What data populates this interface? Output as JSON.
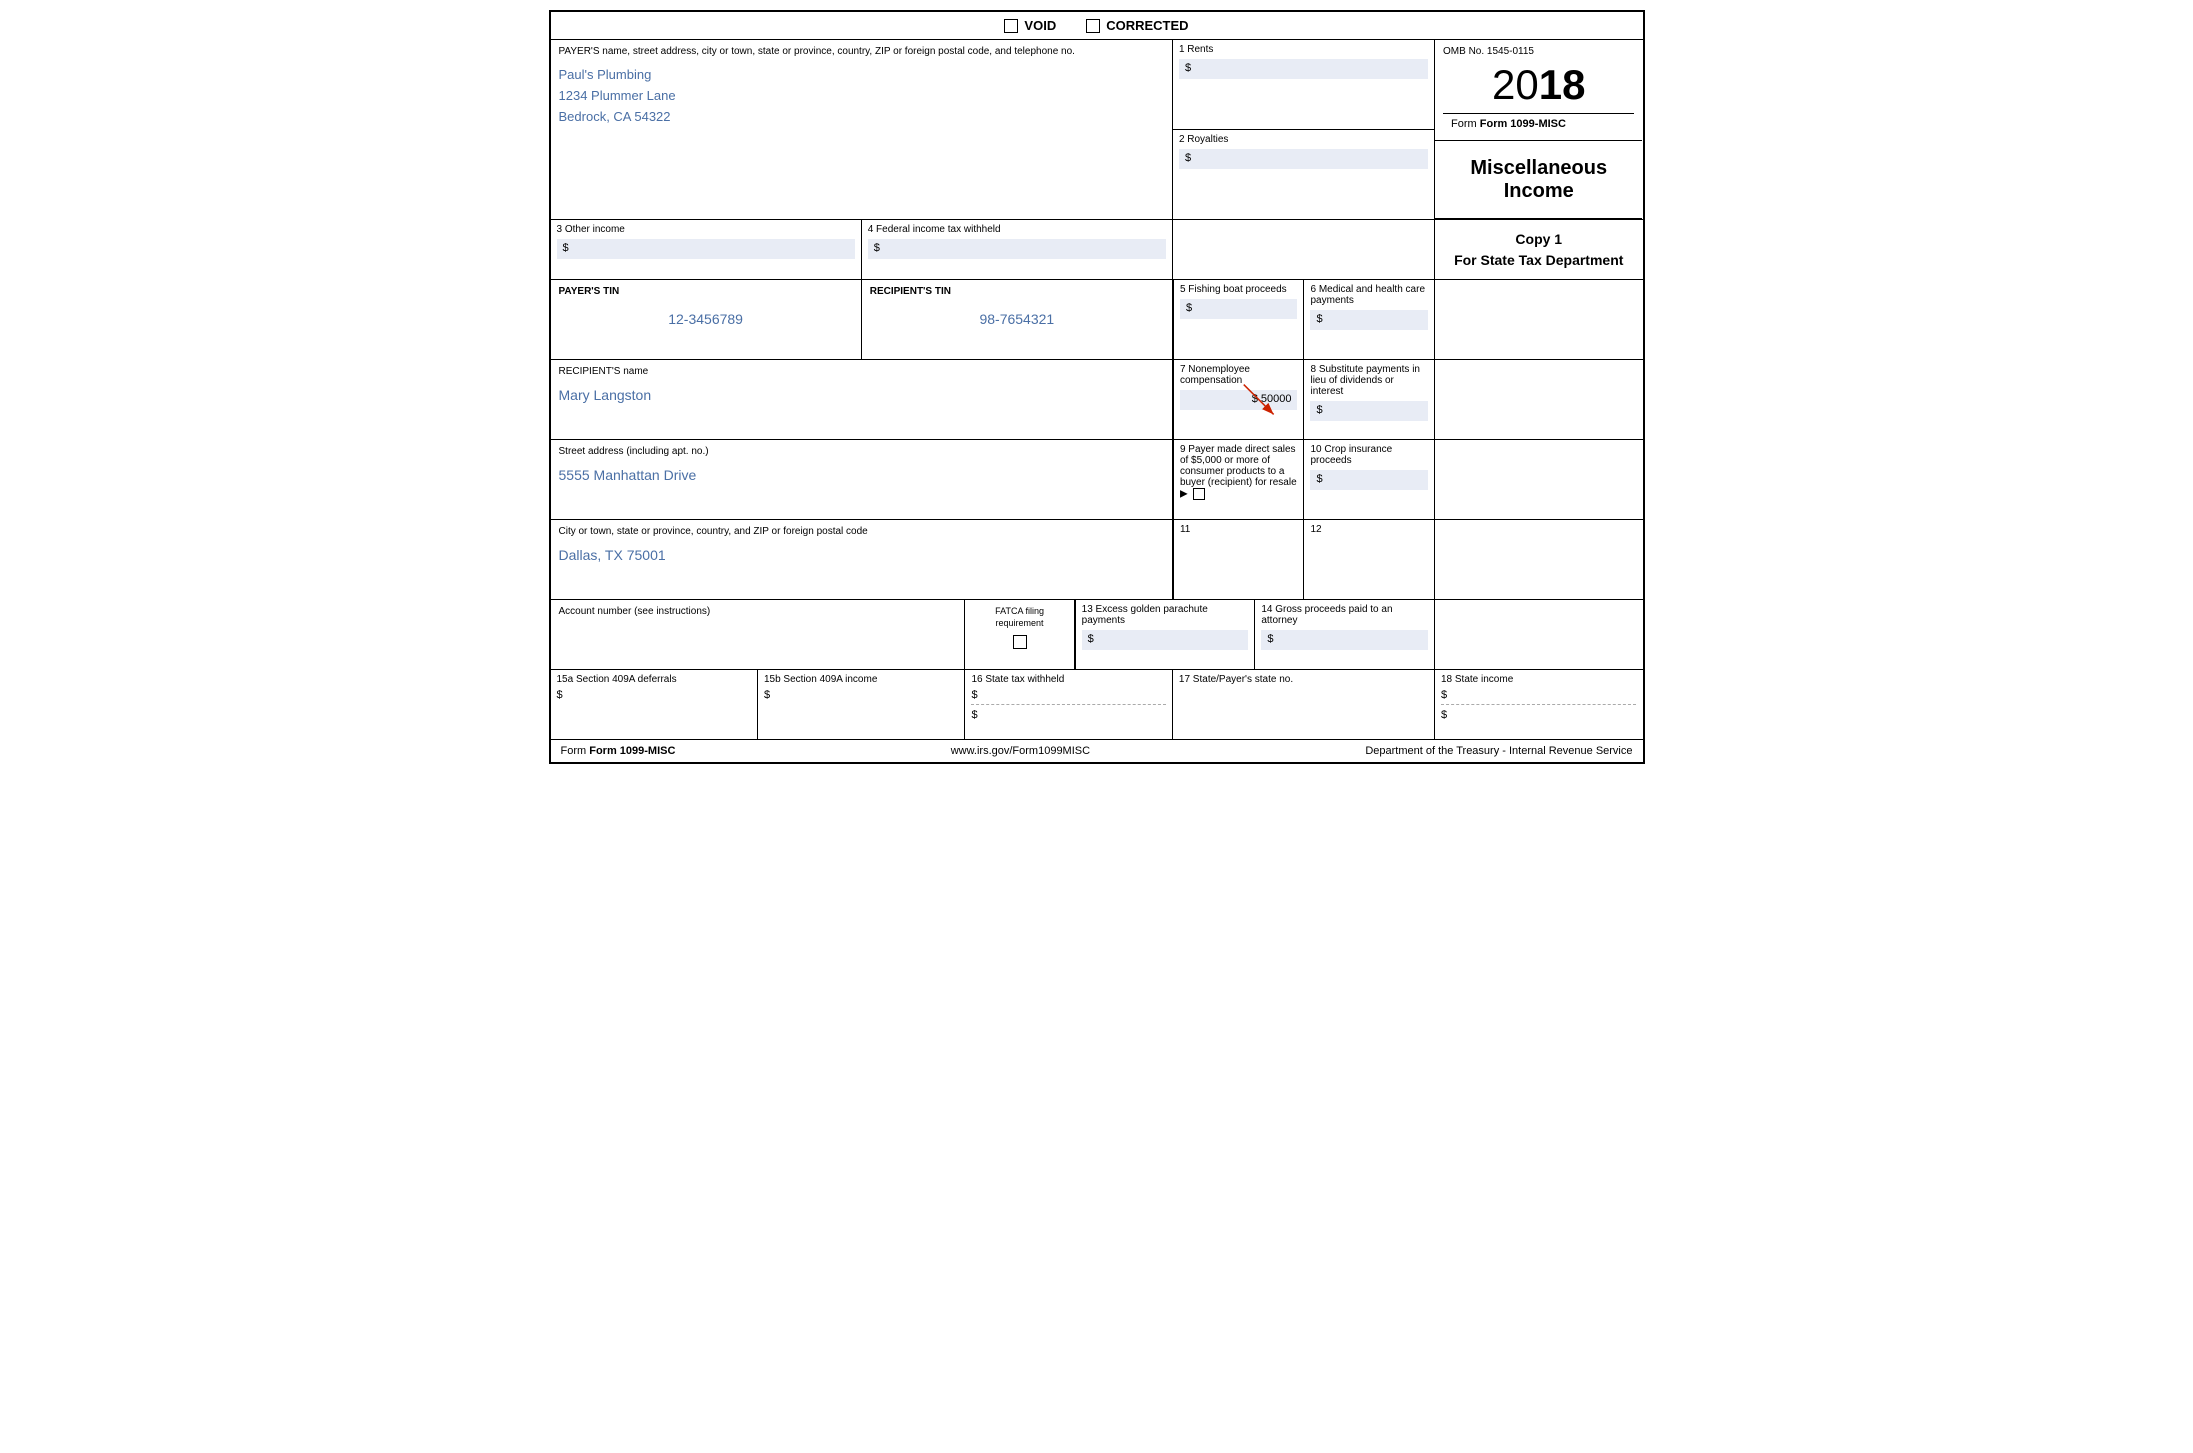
{
  "form": {
    "title": "Form 1099-MISC",
    "year": "2018",
    "year_prefix": "20",
    "year_suffix": "18",
    "omb": "OMB No. 1545-0115",
    "form_label": "Form 1099-MISC",
    "misc_income": "Miscellaneous Income",
    "copy_label": "Copy 1",
    "copy_for": "For State Tax Department",
    "website": "www.irs.gov/Form1099MISC",
    "dept": "Department of the Treasury - Internal Revenue Service"
  },
  "header": {
    "void_label": "VOID",
    "corrected_label": "CORRECTED"
  },
  "payer": {
    "label": "PAYER'S name, street address, city or town, state or province, country, ZIP or foreign postal code, and telephone no.",
    "name": "Paul's Plumbing",
    "address": "1234 Plummer Lane",
    "city_state_zip": "Bedrock, CA 54322"
  },
  "tins": {
    "payer_tin_label": "PAYER'S TIN",
    "recipient_tin_label": "RECIPIENT'S TIN",
    "payer_tin_value": "12-3456789",
    "recipient_tin_value": "98-7654321"
  },
  "recipient": {
    "name_label": "RECIPIENT'S name",
    "name_value": "Mary Langston",
    "street_label": "Street address (including apt. no.)",
    "street_value": "5555 Manhattan Drive",
    "city_label": "City or town, state or province, country, and ZIP or foreign postal code",
    "city_value": "Dallas, TX 75001"
  },
  "account": {
    "label": "Account number (see instructions)",
    "fatca_label": "FATCA filing requirement"
  },
  "boxes": {
    "b1_label": "1 Rents",
    "b1_value": "",
    "b2_label": "2 Royalties",
    "b2_value": "",
    "b3_label": "3 Other income",
    "b3_value": "",
    "b4_label": "4 Federal income tax withheld",
    "b4_value": "",
    "b5_label": "5 Fishing boat proceeds",
    "b5_value": "",
    "b6_label": "6 Medical and health care payments",
    "b6_value": "",
    "b7_label": "7 Nonemployee compensation",
    "b7_value": "50000",
    "b8_label": "8 Substitute payments in lieu of dividends or interest",
    "b8_value": "",
    "b9_label": "9 Payer made direct sales of $5,000 or more of consumer products to a buyer (recipient) for resale ▶",
    "b10_label": "10 Crop insurance proceeds",
    "b10_value": "",
    "b11_label": "11",
    "b12_label": "12",
    "b13_label": "13 Excess golden parachute payments",
    "b13_value": "",
    "b14_label": "14 Gross proceeds paid to an attorney",
    "b14_value": "",
    "b15a_label": "15a Section 409A deferrals",
    "b15a_value": "",
    "b15b_label": "15b Section 409A income",
    "b15b_value": "",
    "b16_label": "16 State tax withheld",
    "b16_value": "",
    "b17_label": "17 State/Payer's state no.",
    "b17_value": "",
    "b18_label": "18 State income",
    "b18_value": ""
  }
}
